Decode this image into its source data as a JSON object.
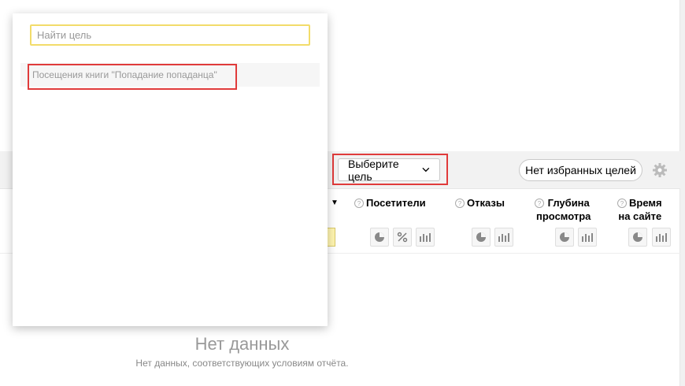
{
  "dropdown": {
    "search_placeholder": "Найти цель",
    "items": [
      "Посещения книги \"Попадание попаданца\""
    ]
  },
  "toolbar": {
    "goal_select_label": "Выберите цель",
    "no_favorites_label": "Нет избранных целей"
  },
  "columns": {
    "visitors": "Посетители",
    "bounces": "Отказы",
    "depth_line1": "Глубина",
    "depth_line2": "просмотра",
    "time_line1": "Время",
    "time_line2": "на сайте",
    "help_mark": "?"
  },
  "empty": {
    "title": "Нет данных",
    "subtitle": "Нет данных, соответствующих условиям отчёта."
  },
  "colors": {
    "highlight_red": "#e03b3b",
    "search_border": "#f2dc6a"
  }
}
